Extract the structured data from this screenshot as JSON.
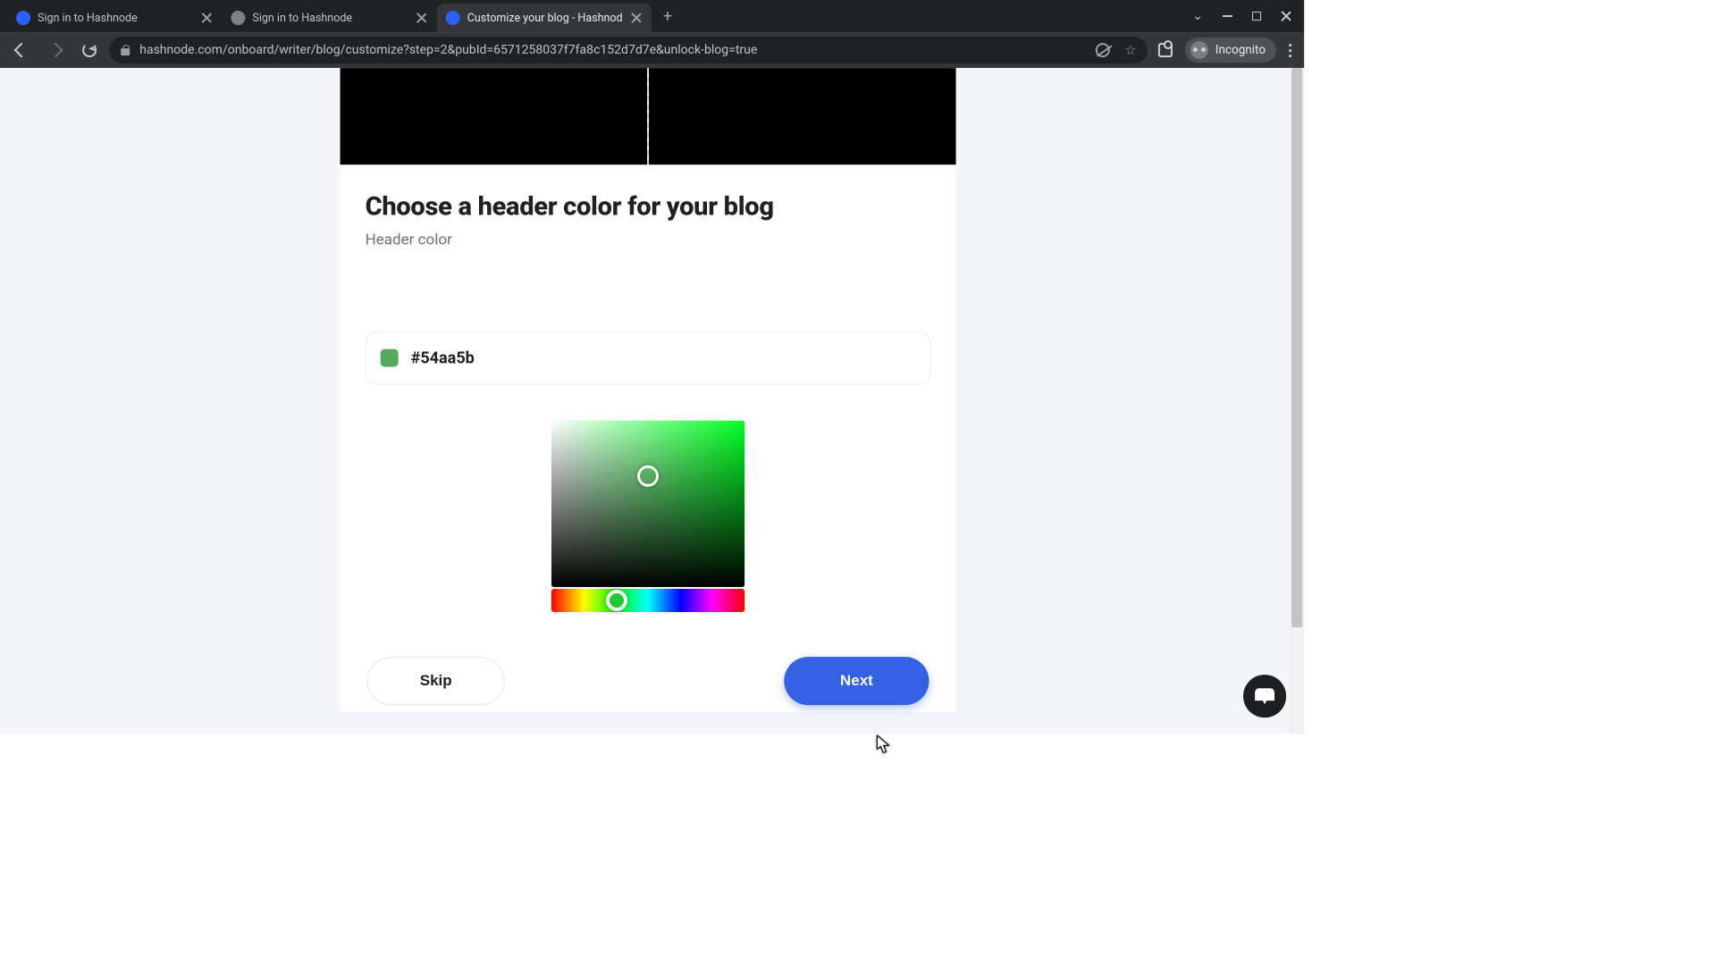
{
  "browser": {
    "tabs": [
      {
        "title": "Sign in to Hashnode",
        "active": false,
        "favicon": "hashnode"
      },
      {
        "title": "Sign in to Hashnode",
        "active": false,
        "favicon": "globe"
      },
      {
        "title": "Customize your blog - Hashnod",
        "active": true,
        "favicon": "hashnode"
      }
    ],
    "url": "hashnode.com/onboard/writer/blog/customize?step=2&pubId=6571258037f7fa8c152d7d7e&unlock-blog=true",
    "incognitoLabel": "Incognito"
  },
  "page": {
    "title": "Choose a header color for your blog",
    "subtitle": "Header color",
    "hex": "#54aa5b",
    "swatchColor": "#54aa5b",
    "skipLabel": "Skip",
    "nextLabel": "Next"
  }
}
